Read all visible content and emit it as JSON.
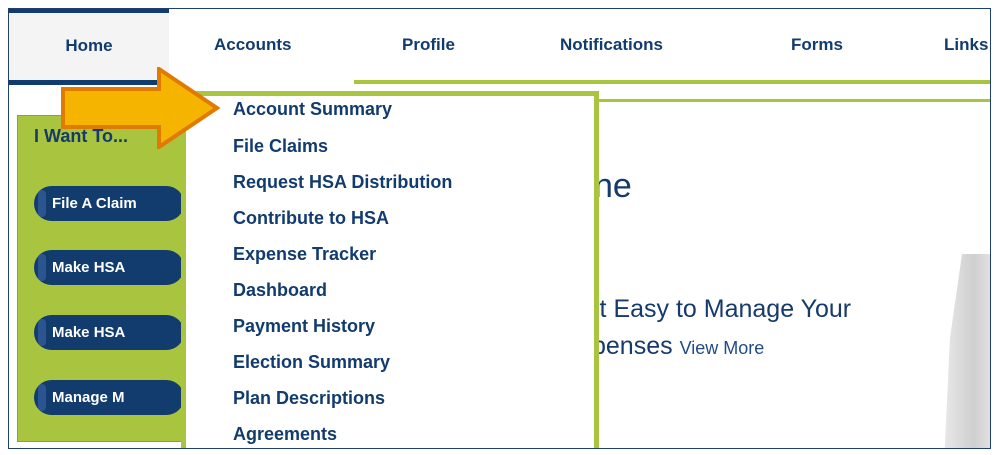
{
  "nav": {
    "items": [
      {
        "label": "Home"
      },
      {
        "label": "Accounts"
      },
      {
        "label": "Profile"
      },
      {
        "label": "Notifications"
      },
      {
        "label": "Forms"
      },
      {
        "label": "Links"
      }
    ]
  },
  "sidebar": {
    "title": "I Want To...",
    "buttons": [
      {
        "label": "File A Claim"
      },
      {
        "label": "Make HSA"
      },
      {
        "label": "Make HSA"
      },
      {
        "label": "Manage M"
      }
    ]
  },
  "dropdown": {
    "items": [
      {
        "label": "Account Summary"
      },
      {
        "label": "File Claims"
      },
      {
        "label": "Request HSA Distribution"
      },
      {
        "label": "Contribute to HSA"
      },
      {
        "label": "Expense Tracker"
      },
      {
        "label": "Dashboard"
      },
      {
        "label": "Payment History"
      },
      {
        "label": "Election Summary"
      },
      {
        "label": "Plan Descriptions"
      },
      {
        "label": "Agreements"
      }
    ]
  },
  "content": {
    "title": "ne",
    "line1": "it Easy to Manage Your",
    "line2": "penses",
    "view_more": "View More"
  },
  "colors": {
    "navy": "#123b6e",
    "green": "#a9c43f",
    "arrow": "#f5b400"
  },
  "icons": {
    "arrow": "right-arrow-icon"
  }
}
